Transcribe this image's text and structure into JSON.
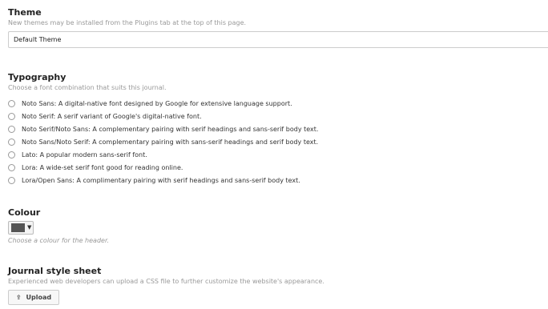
{
  "theme": {
    "heading": "Theme",
    "description": "New themes may be installed from the Plugins tab at the top of this page.",
    "selected": "Default Theme"
  },
  "typography": {
    "heading": "Typography",
    "description": "Choose a font combination that suits this journal.",
    "options": [
      "Noto Sans: A digital-native font designed by Google for extensive language support.",
      "Noto Serif: A serif variant of Google's digital-native font.",
      "Noto Serif/Noto Sans: A complementary pairing with serif headings and sans-serif body text.",
      "Noto Sans/Noto Serif: A complementary pairing with sans-serif headings and serif body text.",
      "Lato: A popular modern sans-serif font.",
      "Lora: A wide-set serif font good for reading online.",
      "Lora/Open Sans: A complimentary pairing with serif headings and sans-serif body text."
    ]
  },
  "colour": {
    "heading": "Colour",
    "description": "Choose a colour for the header.",
    "swatch_color": "#555555",
    "caret": "▼"
  },
  "stylesheet": {
    "heading": "Journal style sheet",
    "description": "Experienced web developers can upload a CSS file to further customize the website's appearance.",
    "upload_label": "Upload",
    "upload_icon": "upload-icon"
  }
}
